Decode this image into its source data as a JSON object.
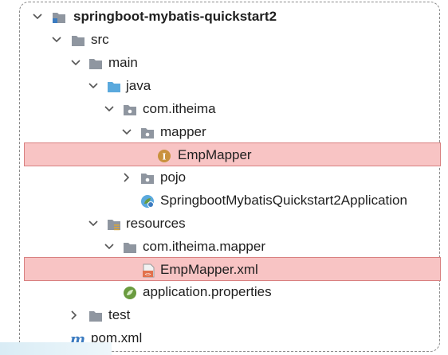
{
  "project_tree": {
    "root": {
      "label": "springboot-mybatis-quickstart2"
    },
    "src": {
      "label": "src"
    },
    "main": {
      "label": "main"
    },
    "java": {
      "label": "java"
    },
    "pkg": {
      "label": "com.itheima"
    },
    "mapper": {
      "label": "mapper"
    },
    "emp_mapper": {
      "label": "EmpMapper"
    },
    "pojo": {
      "label": "pojo"
    },
    "app": {
      "label": "SpringbootMybatisQuickstart2Application"
    },
    "resources": {
      "label": "resources"
    },
    "res_pkg": {
      "label": "com.itheima.mapper"
    },
    "emp_mapper_xml": {
      "label": "EmpMapper.xml"
    },
    "app_props": {
      "label": "application.properties"
    },
    "test": {
      "label": "test"
    },
    "pom": {
      "label": "pom.xml"
    }
  },
  "colors": {
    "highlight_fill": "#f8c4c4",
    "highlight_border": "#d98080",
    "folder_gray": "#8f96a0",
    "folder_blue": "#5aa9dd",
    "interface_orange": "#c9913d",
    "xml_orange": "#e2714d",
    "spring_green": "#6a9b3f",
    "maven_blue": "#3b7bc0"
  },
  "icons": {
    "root": "module-folder-icon",
    "src": "folder-icon",
    "java": "source-root-folder-icon",
    "package": "package-icon",
    "interface": "interface-icon",
    "spring_class": "spring-boot-class-icon",
    "resources": "resources-root-folder-icon",
    "xml": "xml-file-icon",
    "properties": "spring-properties-icon",
    "maven": "maven-icon"
  }
}
